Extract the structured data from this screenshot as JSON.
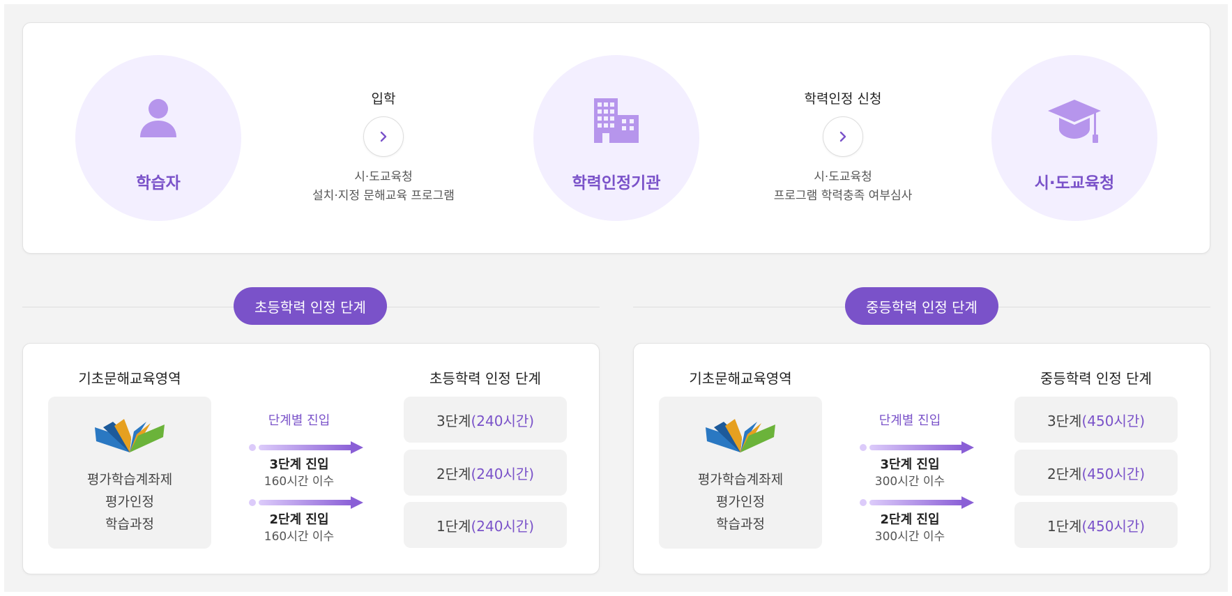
{
  "flow": {
    "nodes": [
      {
        "title": "학습자",
        "icon": "person-icon"
      },
      {
        "title": "학력인정기관",
        "icon": "building-icon"
      },
      {
        "title": "시·도교육청",
        "icon": "graduation-cap-icon"
      }
    ],
    "steps": [
      {
        "title": "입학",
        "desc1": "시·도교육청",
        "desc2": "설치·지정 문해교육 프로그램"
      },
      {
        "title": "학력인정 신청",
        "desc1": "시·도교육청",
        "desc2": "프로그램 학력충족 여부심사"
      }
    ]
  },
  "sections": [
    {
      "pill": "초등학력 인정 단계",
      "left_title": "기초문해교육영역",
      "right_title": "초등학력 인정 단계",
      "area_lines": [
        "평가학습계좌제",
        "평가인정",
        "학습과정"
      ],
      "entry_title": "단계별 진입",
      "entries": [
        {
          "label": "3단계 진입",
          "sub": "160시간 이수"
        },
        {
          "label": "2단계 진입",
          "sub": "160시간 이수"
        }
      ],
      "stages": [
        {
          "name": "3단계",
          "hours": "(240시간)"
        },
        {
          "name": "2단계",
          "hours": "(240시간)"
        },
        {
          "name": "1단계",
          "hours": "(240시간)"
        }
      ]
    },
    {
      "pill": "중등학력 인정 단계",
      "left_title": "기초문해교육영역",
      "right_title": "중등학력 인정 단계",
      "area_lines": [
        "평가학습계좌제",
        "평가인정",
        "학습과정"
      ],
      "entry_title": "단계별 진입",
      "entries": [
        {
          "label": "3단계 진입",
          "sub": "300시간 이수"
        },
        {
          "label": "2단계 진입",
          "sub": "300시간 이수"
        }
      ],
      "stages": [
        {
          "name": "3단계",
          "hours": "(450시간)"
        },
        {
          "name": "2단계",
          "hours": "(450시간)"
        },
        {
          "name": "1단계",
          "hours": "(450시간)"
        }
      ]
    }
  ],
  "colors": {
    "accent": "#7a52c9",
    "circle_bg": "#f3efff",
    "box_bg": "#f2f2f2",
    "page_bg": "#f3f3f3"
  }
}
